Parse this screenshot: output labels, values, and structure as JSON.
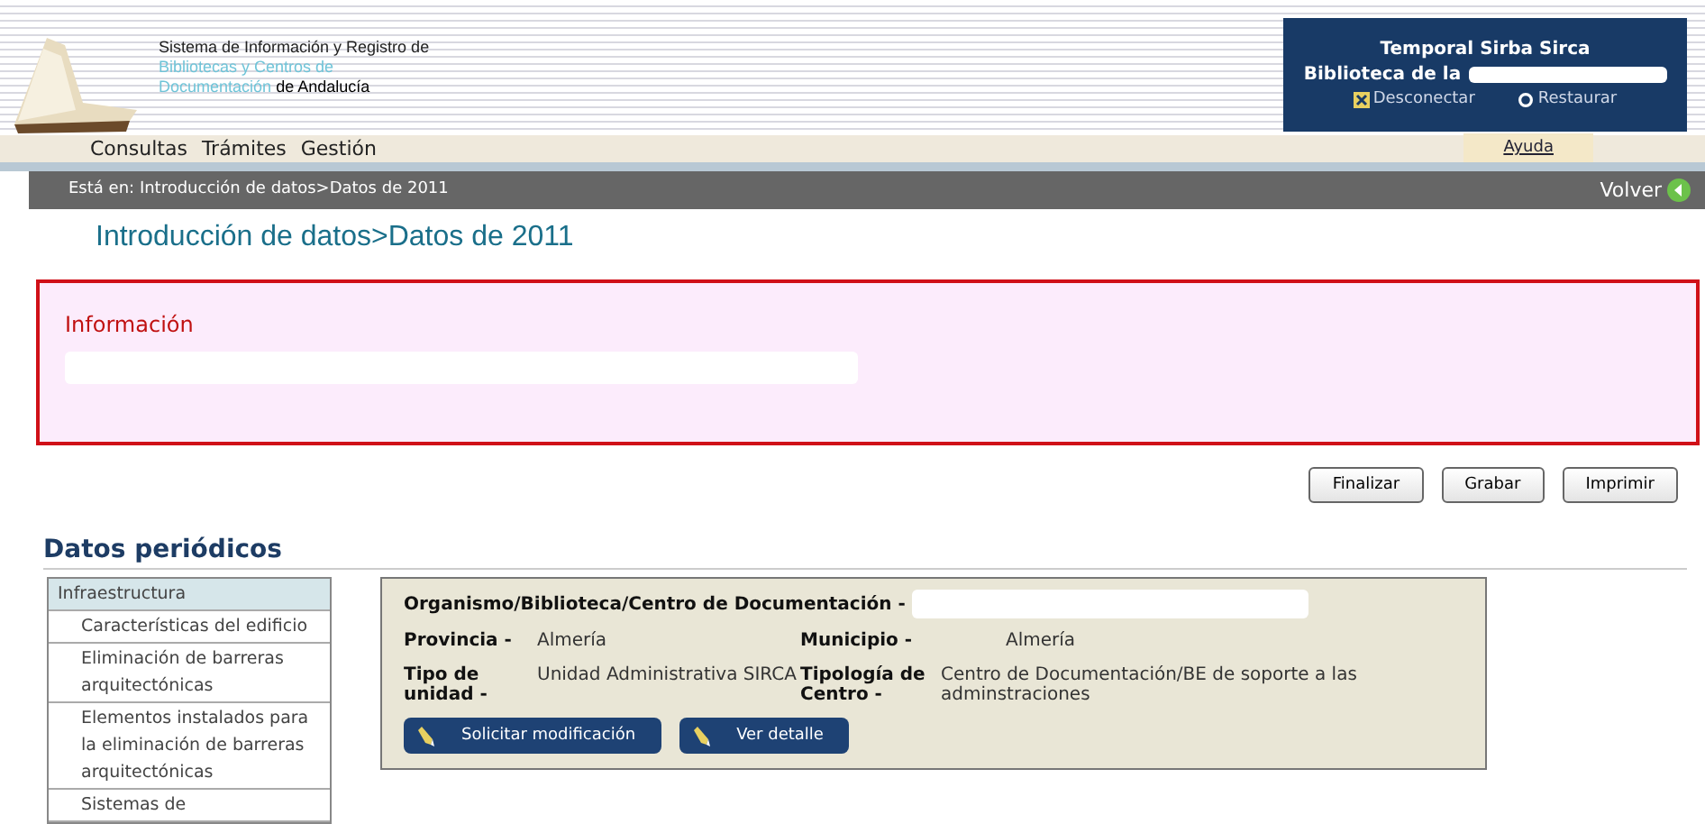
{
  "header": {
    "title_lines": [
      "Sistema de Información y Registro de",
      "Bibliotecas y Centros de"
    ],
    "title_last": {
      "highlight": "Documentación",
      "rest": "de Andalucía"
    },
    "user": {
      "name": "Temporal Sirba Sirca",
      "library": "Biblioteca de la",
      "actions": [
        {
          "label": "Desconectar",
          "kind": "disconnect"
        },
        {
          "label": "Restaurar",
          "kind": "restore"
        }
      ]
    }
  },
  "menu": [
    "Consultas",
    "Trámites",
    "Gestión"
  ],
  "help": "Ayuda",
  "breadcrumb": {
    "label": "Está en:",
    "path": "Introducción de datos>Datos de 2011"
  },
  "back": "Volver",
  "page_title": "Introducción de datos>Datos de 2011",
  "info": {
    "title": "Información"
  },
  "buttons": [
    "Finalizar",
    "Grabar",
    "Imprimir"
  ],
  "section_title": "Datos periódicos",
  "sidebar": {
    "items": [
      {
        "label": "Infraestructura",
        "selected": true
      },
      {
        "label": "Características del edificio",
        "selected": false
      },
      {
        "label": "Eliminación de barreras arquitectónicas",
        "selected": false
      },
      {
        "label": "Elementos instalados para la eliminación de barreras arquitectónicas",
        "selected": false
      },
      {
        "label": "Sistemas de",
        "selected": false
      }
    ]
  },
  "card": {
    "heading": "Organismo/Biblioteca/Centro de Documentación -",
    "fields": [
      {
        "label": "Provincia -",
        "value": "Almería"
      },
      {
        "label": "Municipio -",
        "value": "Almería"
      },
      {
        "label": "Tipo de unidad -",
        "value": "Unidad Administrativa SIRCA"
      },
      {
        "label": "Tipología de Centro -",
        "value": "Centro de Documentación/BE de soporte a las adminstraciones"
      }
    ],
    "buttons": [
      "Solicitar modificación",
      "Ver detalle"
    ]
  }
}
